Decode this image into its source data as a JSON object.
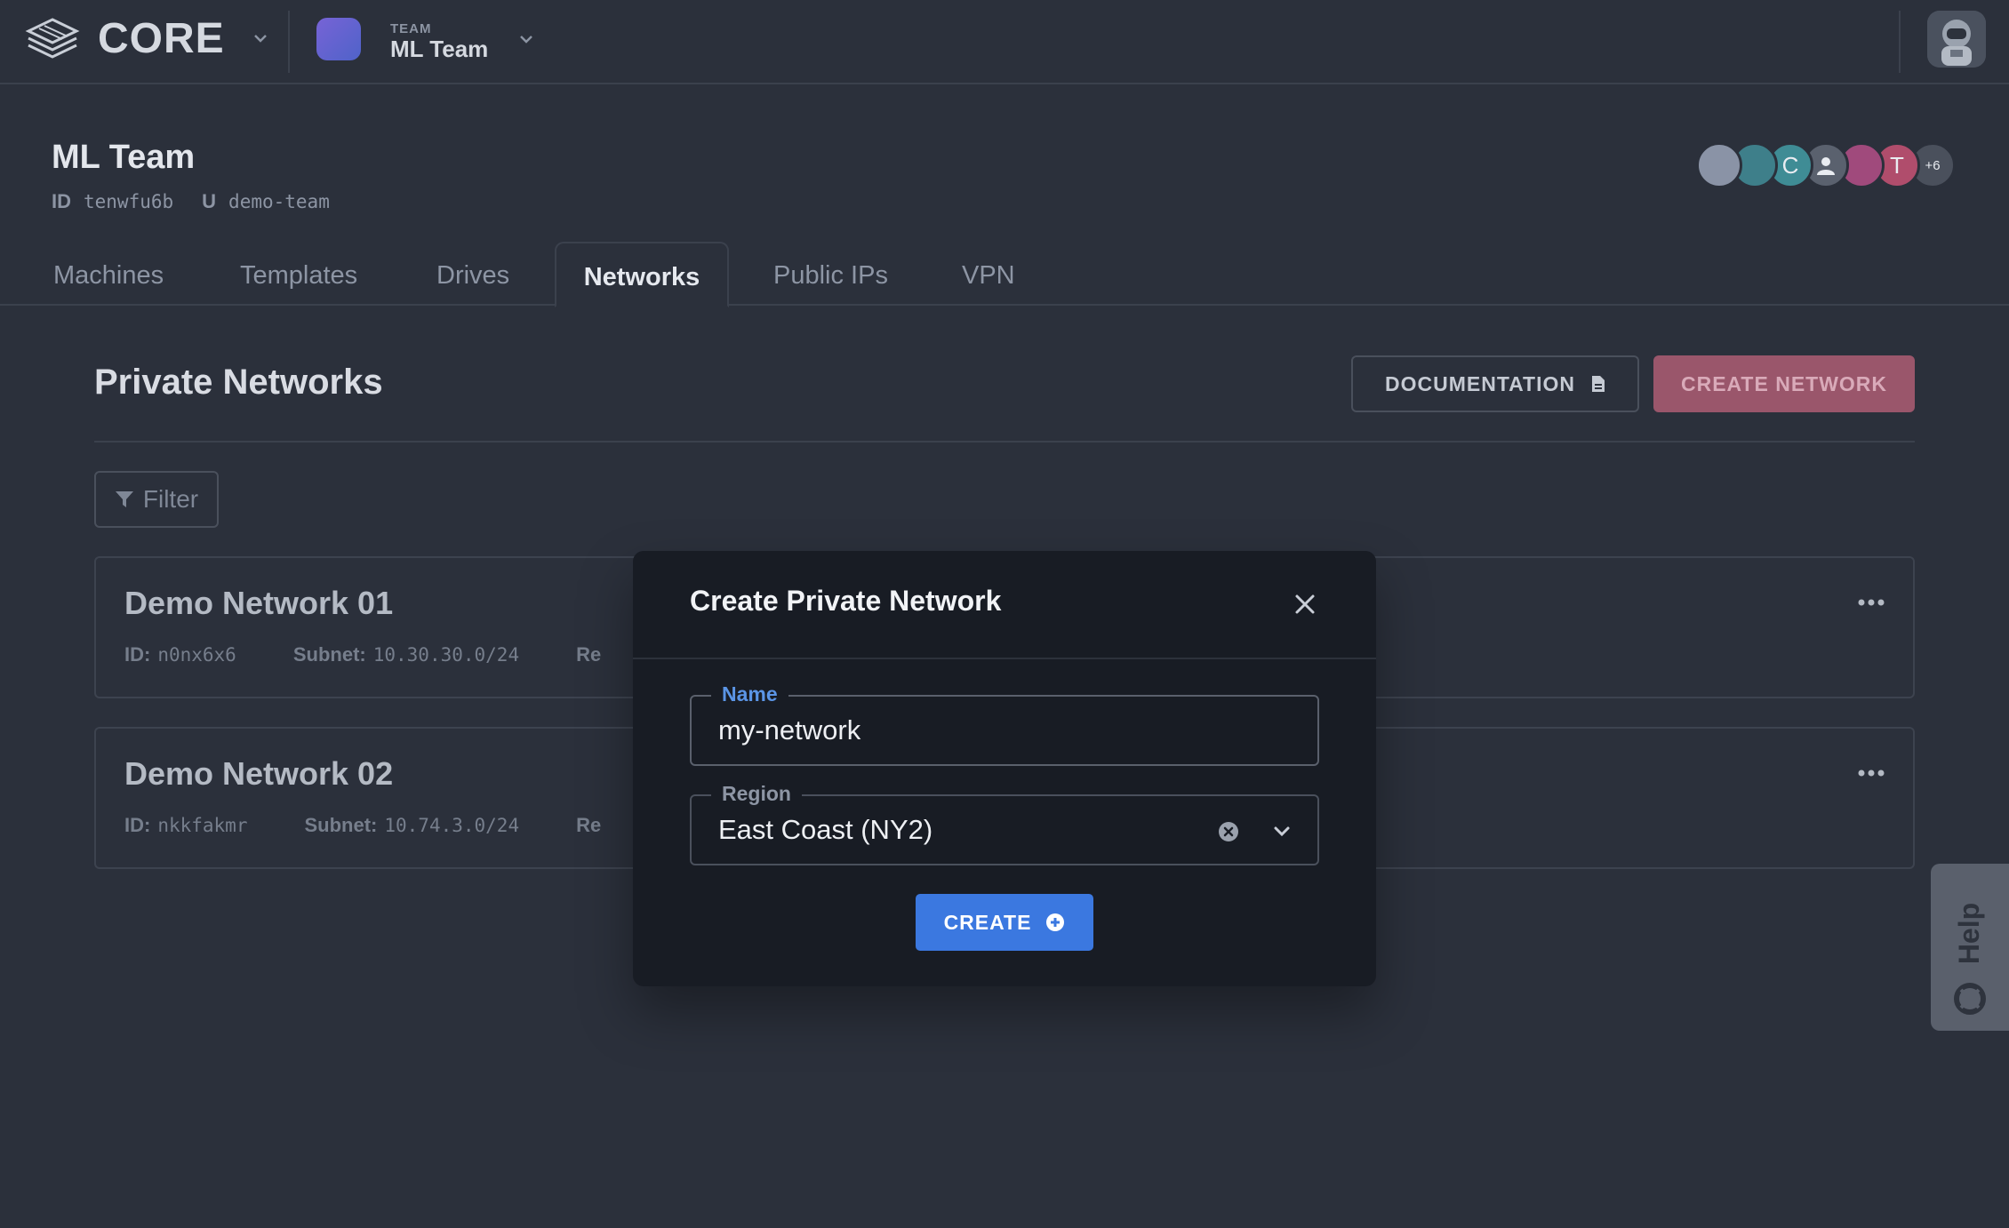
{
  "topbar": {
    "brand": "CORE",
    "team_kicker": "TEAM",
    "team_name": "ML Team"
  },
  "team": {
    "title": "ML Team",
    "id_label": "ID",
    "id_value": "tenwfu6b",
    "u_label": "U",
    "u_value": "demo-team",
    "members": [
      {
        "initial": "",
        "color": "#8a93a6"
      },
      {
        "initial": "",
        "color": "#3e7f8a"
      },
      {
        "initial": "C",
        "color": "#3f8c95"
      },
      {
        "initial": "",
        "color": "#5a616e"
      },
      {
        "initial": "",
        "color": "#a04a7c"
      },
      {
        "initial": "T",
        "color": "#b04d6c"
      },
      {
        "initial": "+6",
        "color": "#4a505c"
      }
    ]
  },
  "tabs": [
    {
      "label": "Machines",
      "active": false
    },
    {
      "label": "Templates",
      "active": false
    },
    {
      "label": "Drives",
      "active": false
    },
    {
      "label": "Networks",
      "active": true
    },
    {
      "label": "Public IPs",
      "active": false
    },
    {
      "label": "VPN",
      "active": false
    }
  ],
  "main": {
    "section_title": "Private Networks",
    "documentation_label": "DOCUMENTATION",
    "create_network_label": "CREATE NETWORK",
    "filter_label": "Filter"
  },
  "networks": [
    {
      "name": "Demo Network 01",
      "id_label": "ID:",
      "id": "n0nx6x6",
      "subnet_label": "Subnet:",
      "subnet": "10.30.30.0/24",
      "region_label": "Re"
    },
    {
      "name": "Demo Network 02",
      "id_label": "ID:",
      "id": "nkkfakmr",
      "subnet_label": "Subnet:",
      "subnet": "10.74.3.0/24",
      "region_label": "Re"
    }
  ],
  "help_label": "Help",
  "modal": {
    "title": "Create Private Network",
    "name_label": "Name",
    "name_value": "my-network",
    "region_label": "Region",
    "region_value": "East Coast (NY2)",
    "create_label": "CREATE"
  },
  "colors": {
    "accent_blue": "#3b78e0",
    "label_blue": "#5b95e6",
    "brand_pink": "#9a566b"
  }
}
